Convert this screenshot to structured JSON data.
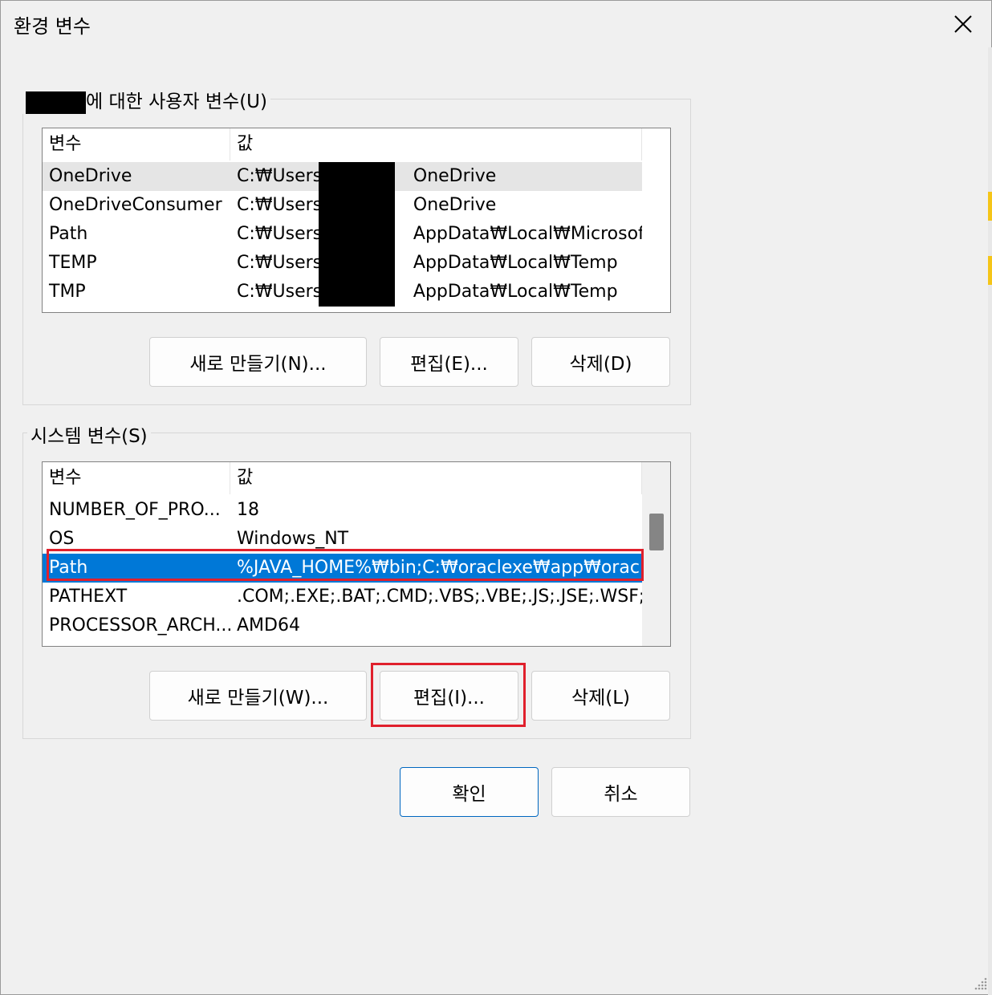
{
  "window": {
    "title": "환경 변수",
    "close_label": "✕"
  },
  "user_vars": {
    "group_label": "에 대한 사용자 변수(U)",
    "columns": [
      "변수",
      "값"
    ],
    "rows": [
      {
        "name": "OneDrive",
        "value_prefix": "C:₩Users₩",
        "value_suffix": "OneDrive"
      },
      {
        "name": "OneDriveConsumer",
        "value_prefix": "C:₩Users₩",
        "value_suffix": "OneDrive"
      },
      {
        "name": "Path",
        "value_prefix": "C:₩Users₩",
        "value_suffix": "AppData₩Local₩Microsoft..."
      },
      {
        "name": "TEMP",
        "value_prefix": "C:₩Users₩",
        "value_suffix": "AppData₩Local₩Temp"
      },
      {
        "name": "TMP",
        "value_prefix": "C:₩Users₩",
        "value_suffix": "AppData₩Local₩Temp"
      }
    ],
    "buttons": {
      "new": "새로 만들기(N)...",
      "edit": "편집(E)...",
      "delete": "삭제(D)"
    }
  },
  "system_vars": {
    "group_label": "시스템 변수(S)",
    "columns": [
      "변수",
      "값"
    ],
    "rows": [
      {
        "name": "NUMBER_OF_PRO...",
        "value": "18"
      },
      {
        "name": "OS",
        "value": "Windows_NT"
      },
      {
        "name": "Path",
        "value": "%JAVA_HOME%₩bin;C:₩oraclexe₩app₩orac..."
      },
      {
        "name": "PATHEXT",
        "value": ".COM;.EXE;.BAT;.CMD;.VBS;.VBE;.JS;.JSE;.WSF;...."
      },
      {
        "name": "PROCESSOR_ARCH...",
        "value": "AMD64"
      }
    ],
    "selected_index": 2,
    "buttons": {
      "new": "새로 만들기(W)...",
      "edit": "편집(I)...",
      "delete": "삭제(L)"
    }
  },
  "footer": {
    "ok": "확인",
    "cancel": "취소"
  },
  "colors": {
    "selection": "#0078d7",
    "highlight": "#e0202c",
    "primary_border": "#0067c0"
  }
}
